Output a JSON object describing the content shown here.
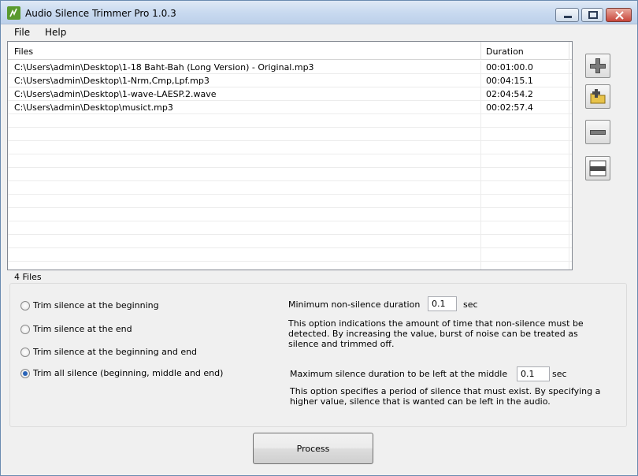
{
  "window": {
    "title": "Audio Silence Trimmer Pro 1.0.3"
  },
  "menu": {
    "file": "File",
    "help": "Help"
  },
  "files": {
    "col_files": "Files",
    "col_duration": "Duration",
    "rows": [
      {
        "path": "C:\\Users\\admin\\Desktop\\1-18 Baht-Bah (Long Version) - Original.mp3",
        "duration": "00:01:00.0"
      },
      {
        "path": "C:\\Users\\admin\\Desktop\\1-Nrm,Cmp,Lpf.mp3",
        "duration": "00:04:15.1"
      },
      {
        "path": "C:\\Users\\admin\\Desktop\\1-wave-LAESP.2.wave",
        "duration": "02:04:54.2"
      },
      {
        "path": "C:\\Users\\admin\\Desktop\\musict.mp3",
        "duration": "00:02:57.4"
      }
    ],
    "count_label": "4 Files"
  },
  "options": {
    "radio_begin": "Trim silence at the beginning",
    "radio_end": "Trim silence at the end",
    "radio_begin_end": "Trim silence at the beginning and end",
    "radio_all": "Trim all silence (beginning, middle and end)",
    "selected": "all",
    "min_nonsilence_label": "Minimum non-silence duration",
    "min_nonsilence_value": "0.1",
    "min_nonsilence_unit": "sec",
    "min_nonsilence_desc": "This option indications the amount of time that non-silence must be detected. By increasing the value, burst of noise can be treated as silence and trimmed off.",
    "max_silence_label": "Maximum silence duration to be left at the middle",
    "max_silence_value": "0.1",
    "max_silence_unit": "sec",
    "max_silence_desc": "This option specifies a period of silence that must exist. By specifying a higher value, silence that is wanted can be left in the audio."
  },
  "buttons": {
    "process": "Process",
    "add_icon": "plus-icon",
    "add_folder_icon": "add-folder-icon",
    "remove_icon": "minus-icon",
    "clear_icon": "clear-list-icon"
  }
}
